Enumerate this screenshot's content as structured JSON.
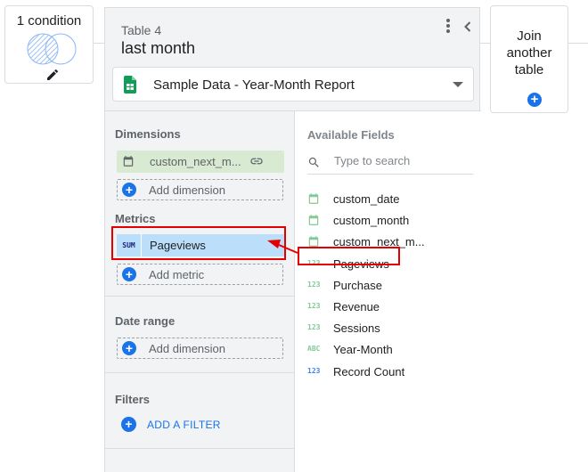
{
  "condition_card": {
    "label": "1 condition",
    "edit_icon": "pencil-icon",
    "venn_icon": "venn-diagram-icon"
  },
  "join_card": {
    "label_line1": "Join",
    "label_line2": "another",
    "label_line3": "table",
    "add_icon": "plus-circle-icon"
  },
  "table": {
    "name": "Table 4",
    "title": "last month",
    "source": "Sample Data - Year-Month Report"
  },
  "dimensions": {
    "header": "Dimensions",
    "chip_label": "custom_next_m...",
    "add_label": "Add dimension"
  },
  "metrics": {
    "header": "Metrics",
    "aggregation": "SUM",
    "chip_label": "Pageviews",
    "add_label": "Add metric"
  },
  "date_range": {
    "header": "Date range",
    "add_label": "Add dimension"
  },
  "filters": {
    "header": "Filters",
    "add_label": "ADD A FILTER"
  },
  "available": {
    "header": "Available Fields",
    "search_placeholder": "Type to search",
    "fields": [
      {
        "label": "custom_date",
        "type": "date"
      },
      {
        "label": "custom_month",
        "type": "date"
      },
      {
        "label": "custom_next_m...",
        "type": "date"
      },
      {
        "label": "Pageviews",
        "type": "123",
        "type_color": "#81c995"
      },
      {
        "label": "Purchase",
        "type": "123",
        "type_color": "#81c995"
      },
      {
        "label": "Revenue",
        "type": "123",
        "type_color": "#81c995"
      },
      {
        "label": "Sessions",
        "type": "123",
        "type_color": "#81c995"
      },
      {
        "label": "Year-Month",
        "type": "ABC",
        "type_color": "#81c995"
      },
      {
        "label": "Record Count",
        "type": "123",
        "type_color": "#4285f4"
      }
    ]
  },
  "colors": {
    "accent": "#1a73e8",
    "highlight": "#e50000",
    "dimension_chip": "#d9ead3",
    "metric_chip": "#bbdefb"
  }
}
